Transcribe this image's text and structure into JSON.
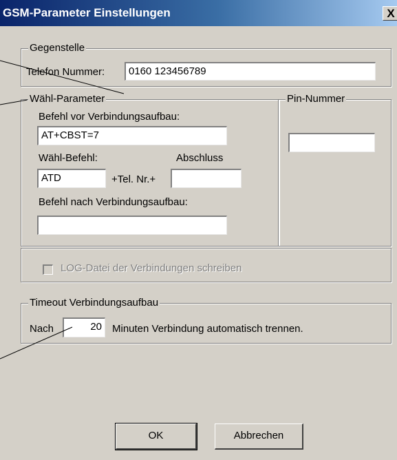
{
  "window": {
    "title": "GSM-Parameter Einstellungen",
    "close_glyph": "X"
  },
  "gegenstelle": {
    "legend": "Gegenstelle",
    "phone_label": "Telefon Nummer:",
    "phone_value": "0160 123456789"
  },
  "waehl": {
    "legend": "Wähl-Parameter",
    "before_label": "Befehl vor Verbindungsaufbau:",
    "before_value": "AT+CBST=7",
    "dial_label": "Wähl-Befehl:",
    "dial_value": "ATD",
    "plus_tel": "+Tel. Nr.+",
    "end_label": "Abschluss",
    "end_value": "",
    "after_label": "Befehl nach Verbindungsaufbau:",
    "after_value": ""
  },
  "pin": {
    "legend": "Pin-Nummer",
    "value": ""
  },
  "log": {
    "label": "LOG-Datei der Verbindungen schreiben",
    "checked": false,
    "enabled": false
  },
  "timeout": {
    "legend": "Timeout Verbindungsaufbau",
    "prefix": "Nach",
    "value": "20",
    "suffix": "Minuten Verbindung automatisch trennen."
  },
  "buttons": {
    "ok": "OK",
    "cancel": "Abbrechen"
  }
}
